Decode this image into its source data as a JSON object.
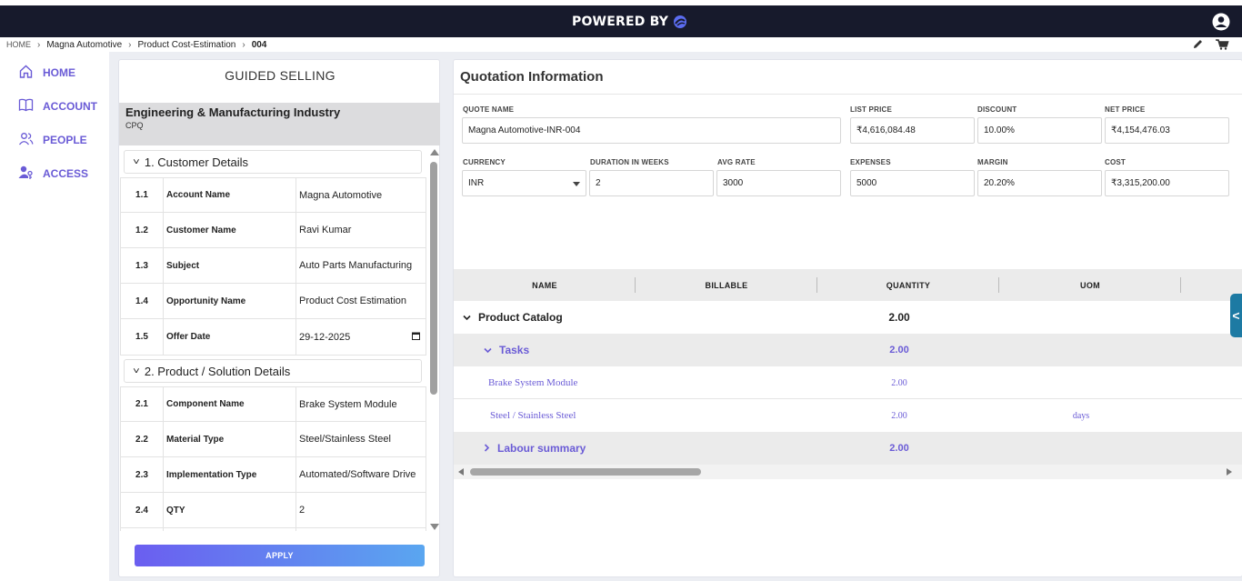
{
  "topbar": {
    "brand": "POWERED BY",
    "brand_logo_icon": "swirl-logo-icon",
    "user_icon": "user-circle-icon"
  },
  "breadcrumb": [
    "HOME",
    "Magna Automotive",
    "Product Cost-Estimation",
    "004"
  ],
  "sidebar": {
    "items": [
      {
        "label": "HOME",
        "icon": "home-icon"
      },
      {
        "label": "ACCOUNT",
        "icon": "book-icon"
      },
      {
        "label": "PEOPLE",
        "icon": "people-icon"
      },
      {
        "label": "ACCESS",
        "icon": "user-key-icon"
      }
    ]
  },
  "guided": {
    "title": "GUIDED SELLING",
    "industry": "Engineering & Manufacturing Industry",
    "industry_sub": "CPQ",
    "sections": [
      {
        "title": "1. Customer Details",
        "rows": [
          {
            "num": "1.1",
            "label": "Account Name",
            "value": "Magna Automotive"
          },
          {
            "num": "1.2",
            "label": "Customer Name",
            "value": "Ravi Kumar"
          },
          {
            "num": "1.3",
            "label": "Subject",
            "value": "Auto Parts Manufacturing"
          },
          {
            "num": "1.4",
            "label": "Opportunity Name",
            "value": "Product Cost Estimation"
          },
          {
            "num": "1.5",
            "label": "Offer Date",
            "value": "29-12-2025"
          }
        ]
      },
      {
        "title": "2. Product / Solution Details",
        "rows": [
          {
            "num": "2.1",
            "label": "Component Name",
            "value": "Brake System Module"
          },
          {
            "num": "2.2",
            "label": "Material Type",
            "value": "Steel/Stainless Steel"
          },
          {
            "num": "2.3",
            "label": "Implementation Type",
            "value": "Automated/Software Drive"
          },
          {
            "num": "2.4",
            "label": "QTY",
            "value": "2"
          }
        ]
      }
    ],
    "apply_label": "APPLY"
  },
  "quotation": {
    "title": "Quotation Information",
    "fields": {
      "quote_name": {
        "label": "QUOTE NAME",
        "value": "Magna Automotive-INR-004"
      },
      "list_price": {
        "label": "LIST PRICE",
        "value": "₹4,616,084.48"
      },
      "discount": {
        "label": "DISCOUNT",
        "value": "10.00%"
      },
      "net_price": {
        "label": "NET PRICE",
        "value": "₹4,154,476.03"
      },
      "currency": {
        "label": "CURRENCY",
        "value": "INR"
      },
      "duration": {
        "label": "DURATION IN WEEKS",
        "value": "2"
      },
      "avg_rate": {
        "label": "AVG RATE",
        "value": "3000"
      },
      "expenses": {
        "label": "EXPENSES",
        "value": "5000"
      },
      "margin": {
        "label": "MARGIN",
        "value": "20.20%"
      },
      "cost": {
        "label": "COST",
        "value": "₹3,315,200.00"
      }
    },
    "grid": {
      "columns": [
        "NAME",
        "BILLABLE",
        "QUANTITY",
        "UOM"
      ],
      "rows": [
        {
          "name": "Product Catalog",
          "quantity": "2.00",
          "uom": "",
          "expanded": true
        },
        {
          "name": "Tasks",
          "quantity": "2.00",
          "uom": "",
          "expanded": true
        },
        {
          "name": "Brake System Module",
          "quantity": "2.00",
          "uom": ""
        },
        {
          "name": "Steel / Stainless Steel",
          "quantity": "2.00",
          "uom": "days"
        },
        {
          "name": "Labour summary",
          "quantity": "2.00",
          "uom": "",
          "expanded": false
        }
      ]
    }
  },
  "side_toggle": "<",
  "colors": {
    "accent": "#6a5bd6",
    "topbar": "#171a2c",
    "toggle": "#1d7aa3"
  }
}
